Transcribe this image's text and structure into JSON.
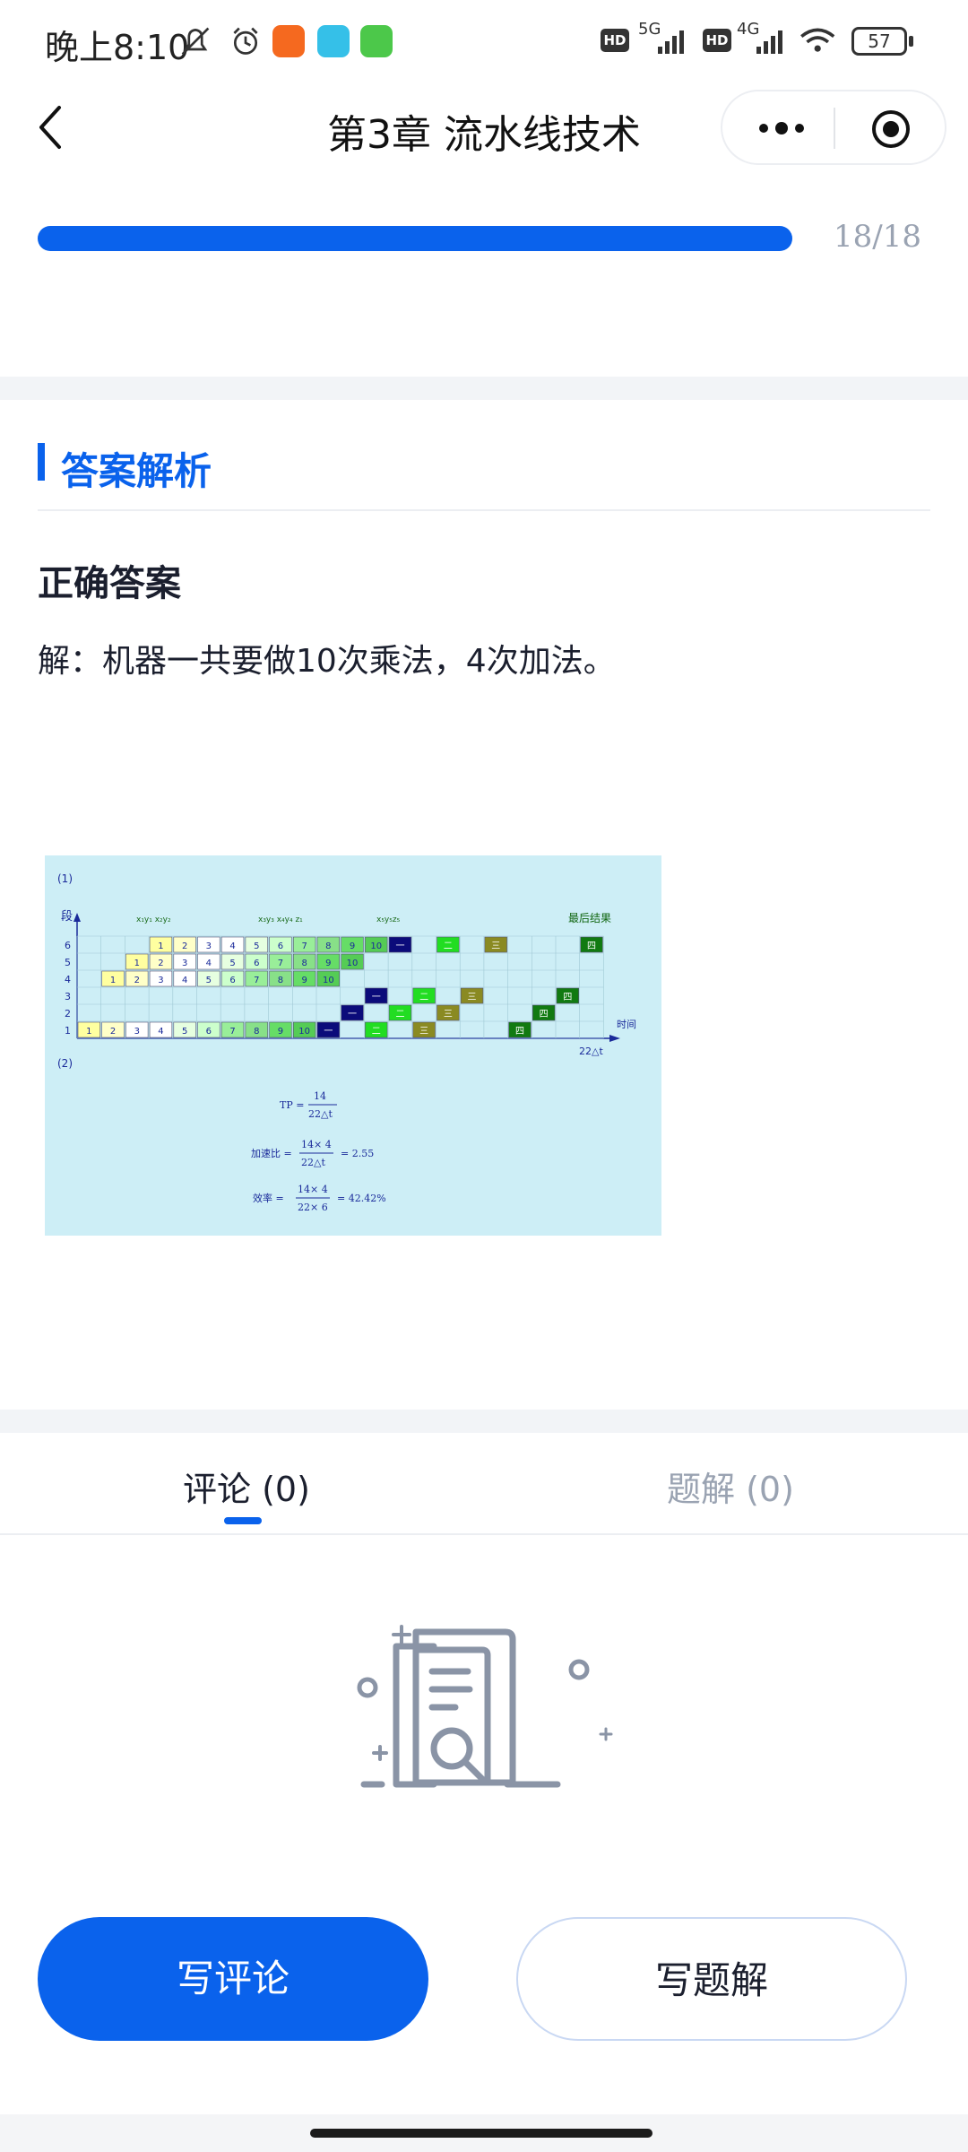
{
  "status_bar": {
    "time": "晚上8:10",
    "network_1": "5G",
    "network_2": "4G",
    "hd_1": "HD",
    "hd_2": "HD",
    "battery": "57"
  },
  "nav": {
    "title": "第3章  流水线技术",
    "back_icon": "chevron-left-icon",
    "more_icon": "more-dots-icon",
    "close_icon": "target-close-icon"
  },
  "progress": {
    "fraction": 1.0,
    "label": "18/18"
  },
  "analysis": {
    "section_title": "答案解析",
    "answer_title": "正确答案",
    "answer_text": "解：机器一共要做10次乘法，4次加法。"
  },
  "figure": {
    "part1_label": "(1)",
    "part2_label": "(2)",
    "y_axis_label": "段",
    "x_axis_label": "时间",
    "x_end_label": "22△t",
    "top_right_label": "最后结果",
    "col_labels": [
      "x₁y₁ x₂y₂",
      "x₃y₃ x₄y₄ z₁",
      "x₅y₅z₅"
    ],
    "stage_labels": [
      "6",
      "5",
      "4",
      "3",
      "2",
      "1"
    ],
    "mult_numbers": [
      "1",
      "2",
      "3",
      "4",
      "5",
      "6",
      "7",
      "8",
      "9",
      "10"
    ],
    "add_marks": [
      "一",
      "二",
      "三",
      "四"
    ],
    "formula_tp_left": "TP =",
    "formula_tp_num": "14",
    "formula_tp_den": "22△t",
    "formula_speedup_left": "加速比 =",
    "formula_speedup_num": "14× 4",
    "formula_speedup_den": "22△t",
    "formula_speedup_val": "= 2.55",
    "formula_eff_left": "效率  =",
    "formula_eff_num": "14× 4",
    "formula_eff_den": "22× 6",
    "formula_eff_val": "= 42.42%"
  },
  "tabs": {
    "comments": "评论 (0)",
    "solutions": "题解 (0)",
    "active": "comments"
  },
  "empty_state_icon": "empty-document-search-icon",
  "buttons": {
    "write_comment": "写评论",
    "write_solution": "写题解"
  },
  "colors": {
    "accent": "#0a62ec",
    "figure_bg": "#cdeef6",
    "divider": "#eceef2"
  }
}
